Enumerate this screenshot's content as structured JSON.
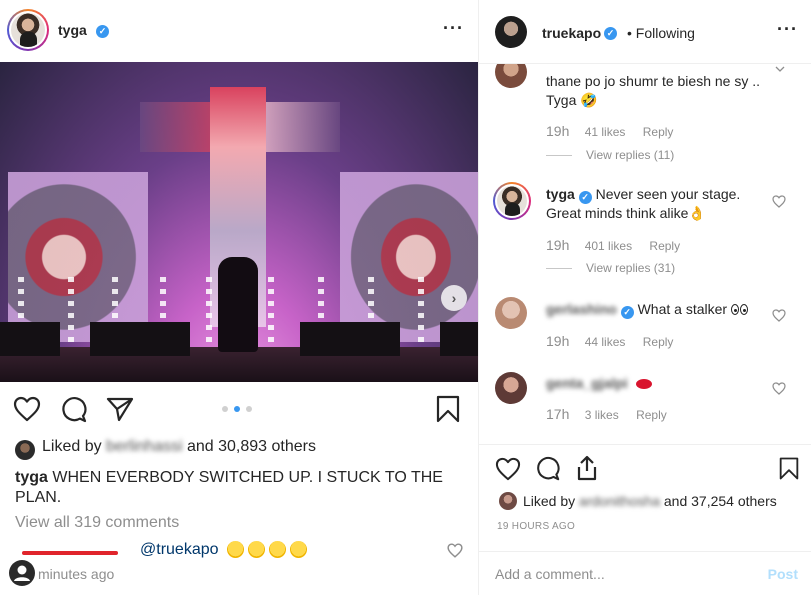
{
  "post": {
    "username": "tyga",
    "liked_by_prefix": "Liked by",
    "liked_by_user": "berlinhassi",
    "liked_by_suffix": "and 30,893 others",
    "caption_user": "tyga",
    "caption_text": "WHEN EVERBODY SWITCHED UP. I STUCK TO THE PLAN.",
    "view_all": "View all 319 comments",
    "mention": "@truekapo",
    "time_ago": "minutes ago",
    "carousel_index": 2,
    "carousel_count": 3
  },
  "panel": {
    "username": "truekapo",
    "following": "• Following",
    "comments": [
      {
        "text": "thane po jo shumr te biesh ne sy .. Tyga 🤣",
        "time": "19h",
        "likes": "41 likes",
        "reply": "Reply",
        "replies": "View replies (11)"
      },
      {
        "user": "tyga",
        "text": "Never seen your stage. Great minds think alike👌",
        "time": "19h",
        "likes": "401 likes",
        "reply": "Reply",
        "replies": "View replies (31)"
      },
      {
        "user": "gerlashino",
        "text": "What a stalker",
        "time": "19h",
        "likes": "44 likes",
        "reply": "Reply"
      },
      {
        "user": "genta_gjalpi",
        "text": "",
        "time": "17h",
        "likes": "3 likes",
        "reply": "Reply"
      }
    ],
    "liked_by_prefix": "Liked by",
    "liked_by_user": "ardonithosha",
    "liked_by_suffix": "and 37,254 others",
    "time_ago": "19 HOURS AGO",
    "comment_placeholder": "Add a comment...",
    "post_label": "Post"
  },
  "colors": {
    "verified": "#3897f0",
    "link": "#00376b",
    "muted": "#8e8e8e",
    "post_disabled": "#b2dffc"
  }
}
